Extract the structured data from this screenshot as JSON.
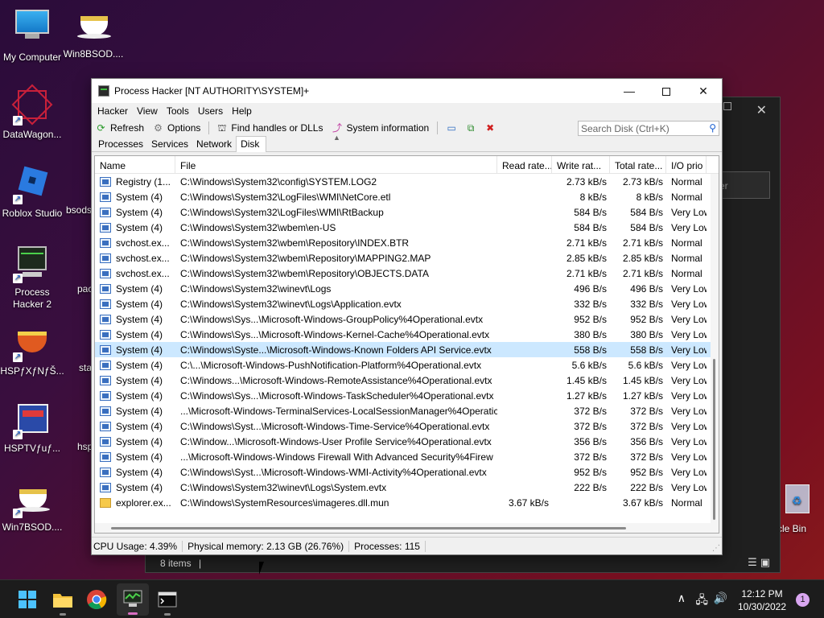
{
  "desktop": {
    "icons": [
      {
        "label": "My Computer"
      },
      {
        "label": "Win8BSOD...."
      },
      {
        "label": "DataWagon..."
      },
      {
        "label": "Roblox Studio"
      },
      {
        "label": "bsods"
      },
      {
        "label": "Process Hacker 2"
      },
      {
        "label": "pac"
      },
      {
        "label": "HSPƒXƒNƒŠ..."
      },
      {
        "label": "sta"
      },
      {
        "label": "HSPTVƒuƒ..."
      },
      {
        "label": "hsp"
      },
      {
        "label": "Win7BSOD...."
      },
      {
        "label": "cle Bin"
      }
    ]
  },
  "background_window": {
    "search_partial": "er",
    "status": "8 items"
  },
  "app": {
    "title": "Process Hacker [NT AUTHORITY\\SYSTEM]+",
    "menu": [
      "Hacker",
      "View",
      "Tools",
      "Users",
      "Help"
    ],
    "toolbar": {
      "refresh": "Refresh",
      "options": "Options",
      "find_handles": "Find handles or DLLs",
      "system_info": "System information",
      "search_placeholder": "Search Disk (Ctrl+K)"
    },
    "tabs": [
      "Processes",
      "Services",
      "Network",
      "Disk"
    ],
    "active_tab": "Disk",
    "columns": [
      "Name",
      "File",
      "Read rate...",
      "Write rat...",
      "Total rate...",
      "I/O prio"
    ],
    "rows": [
      {
        "name": "Registry (1...",
        "file": "C:\\Windows\\System32\\config\\SYSTEM.LOG2",
        "read": "",
        "write": "2.73 kB/s",
        "total": "2.73 kB/s",
        "io": "Normal",
        "icon": "window"
      },
      {
        "name": "System (4)",
        "file": "C:\\Windows\\System32\\LogFiles\\WMI\\NetCore.etl",
        "read": "",
        "write": "8 kB/s",
        "total": "8 kB/s",
        "io": "Normal",
        "icon": "window"
      },
      {
        "name": "System (4)",
        "file": "C:\\Windows\\System32\\LogFiles\\WMI\\RtBackup",
        "read": "",
        "write": "584 B/s",
        "total": "584 B/s",
        "io": "Very Low",
        "icon": "window"
      },
      {
        "name": "System (4)",
        "file": "C:\\Windows\\System32\\wbem\\en-US",
        "read": "",
        "write": "584 B/s",
        "total": "584 B/s",
        "io": "Very Low",
        "icon": "window"
      },
      {
        "name": "svchost.ex...",
        "file": "C:\\Windows\\System32\\wbem\\Repository\\INDEX.BTR",
        "read": "",
        "write": "2.71 kB/s",
        "total": "2.71 kB/s",
        "io": "Normal",
        "icon": "window"
      },
      {
        "name": "svchost.ex...",
        "file": "C:\\Windows\\System32\\wbem\\Repository\\MAPPING2.MAP",
        "read": "",
        "write": "2.85 kB/s",
        "total": "2.85 kB/s",
        "io": "Normal",
        "icon": "window"
      },
      {
        "name": "svchost.ex...",
        "file": "C:\\Windows\\System32\\wbem\\Repository\\OBJECTS.DATA",
        "read": "",
        "write": "2.71 kB/s",
        "total": "2.71 kB/s",
        "io": "Normal",
        "icon": "window"
      },
      {
        "name": "System (4)",
        "file": "C:\\Windows\\System32\\winevt\\Logs",
        "read": "",
        "write": "496 B/s",
        "total": "496 B/s",
        "io": "Very Low",
        "icon": "window"
      },
      {
        "name": "System (4)",
        "file": "C:\\Windows\\System32\\winevt\\Logs\\Application.evtx",
        "read": "",
        "write": "332 B/s",
        "total": "332 B/s",
        "io": "Very Low",
        "icon": "window"
      },
      {
        "name": "System (4)",
        "file": "C:\\Windows\\Sys...\\Microsoft-Windows-GroupPolicy%4Operational.evtx",
        "read": "",
        "write": "952 B/s",
        "total": "952 B/s",
        "io": "Very Low",
        "icon": "window"
      },
      {
        "name": "System (4)",
        "file": "C:\\Windows\\Sys...\\Microsoft-Windows-Kernel-Cache%4Operational.evtx",
        "read": "",
        "write": "380 B/s",
        "total": "380 B/s",
        "io": "Very Low",
        "icon": "window"
      },
      {
        "name": "System (4)",
        "file": "C:\\Windows\\Syste...\\Microsoft-Windows-Known Folders API Service.evtx",
        "read": "",
        "write": "558 B/s",
        "total": "558 B/s",
        "io": "Very Low",
        "icon": "window",
        "selected": true
      },
      {
        "name": "System (4)",
        "file": "C:\\...\\Microsoft-Windows-PushNotification-Platform%4Operational.evtx",
        "read": "",
        "write": "5.6 kB/s",
        "total": "5.6 kB/s",
        "io": "Very Low",
        "icon": "window"
      },
      {
        "name": "System (4)",
        "file": "C:\\Windows...\\Microsoft-Windows-RemoteAssistance%4Operational.evtx",
        "read": "",
        "write": "1.45 kB/s",
        "total": "1.45 kB/s",
        "io": "Very Low",
        "icon": "window"
      },
      {
        "name": "System (4)",
        "file": "C:\\Windows\\Sys...\\Microsoft-Windows-TaskScheduler%4Operational.evtx",
        "read": "",
        "write": "1.27 kB/s",
        "total": "1.27 kB/s",
        "io": "Very Low",
        "icon": "window"
      },
      {
        "name": "System (4)",
        "file": "...\\Microsoft-Windows-TerminalServices-LocalSessionManager%4Operatic",
        "read": "",
        "write": "372 B/s",
        "total": "372 B/s",
        "io": "Very Low",
        "icon": "window"
      },
      {
        "name": "System (4)",
        "file": "C:\\Windows\\Syst...\\Microsoft-Windows-Time-Service%4Operational.evtx",
        "read": "",
        "write": "372 B/s",
        "total": "372 B/s",
        "io": "Very Low",
        "icon": "window"
      },
      {
        "name": "System (4)",
        "file": "C:\\Window...\\Microsoft-Windows-User Profile Service%4Operational.evtx",
        "read": "",
        "write": "356 B/s",
        "total": "356 B/s",
        "io": "Very Low",
        "icon": "window"
      },
      {
        "name": "System (4)",
        "file": "...\\Microsoft-Windows-Windows Firewall With Advanced Security%4Firew",
        "read": "",
        "write": "372 B/s",
        "total": "372 B/s",
        "io": "Very Low",
        "icon": "window"
      },
      {
        "name": "System (4)",
        "file": "C:\\Windows\\Syst...\\Microsoft-Windows-WMI-Activity%4Operational.evtx",
        "read": "",
        "write": "952 B/s",
        "total": "952 B/s",
        "io": "Very Low",
        "icon": "window"
      },
      {
        "name": "System (4)",
        "file": "C:\\Windows\\System32\\winevt\\Logs\\System.evtx",
        "read": "",
        "write": "222 B/s",
        "total": "222 B/s",
        "io": "Very Low",
        "icon": "window"
      },
      {
        "name": "explorer.ex...",
        "file": "C:\\Windows\\SystemResources\\imageres.dll.mun",
        "read": "3.67 kB/s",
        "write": "",
        "total": "3.67 kB/s",
        "io": "Normal",
        "icon": "folder"
      }
    ],
    "status": {
      "cpu": "CPU Usage: 4.39%",
      "memory": "Physical memory: 2.13 GB (26.76%)",
      "processes": "Processes: 115"
    }
  },
  "taskbar": {
    "time": "12:12 PM",
    "date": "10/30/2022",
    "notifications": "1"
  }
}
